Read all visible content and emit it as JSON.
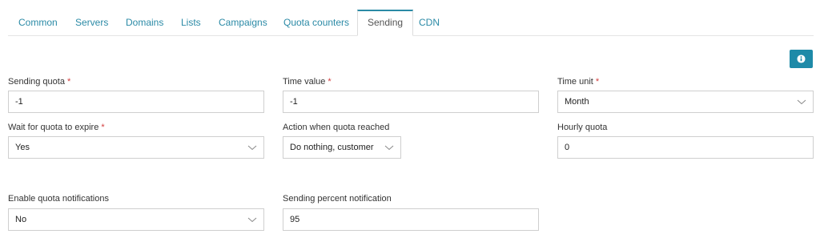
{
  "tabs": [
    {
      "label": "Common"
    },
    {
      "label": "Servers"
    },
    {
      "label": "Domains"
    },
    {
      "label": "Lists"
    },
    {
      "label": "Campaigns"
    },
    {
      "label": "Quota counters"
    },
    {
      "label": "Sending",
      "active": true
    },
    {
      "label": "CDN"
    }
  ],
  "required_mark": "*",
  "info_button": {
    "icon": "info-icon"
  },
  "fields": {
    "sending_quota": {
      "label": "Sending quota",
      "value": "-1"
    },
    "time_value": {
      "label": "Time value",
      "value": "-1"
    },
    "time_unit": {
      "label": "Time unit",
      "value": "Month"
    },
    "wait_for_quota": {
      "label": "Wait for quota to expire",
      "value": "Yes"
    },
    "action_when_reached": {
      "label": "Action when quota reached",
      "value": "Do nothing, customer"
    },
    "hourly_quota": {
      "label": "Hourly quota",
      "value": "0"
    },
    "enable_notifications": {
      "label": "Enable quota notifications",
      "value": "No"
    },
    "percent_notification": {
      "label": "Sending percent notification",
      "value": "95"
    }
  },
  "colors": {
    "accent": "#1e8aa8",
    "tab_text": "#2b8aa6",
    "required": "#d23c3c",
    "border": "#cfcfcf"
  }
}
